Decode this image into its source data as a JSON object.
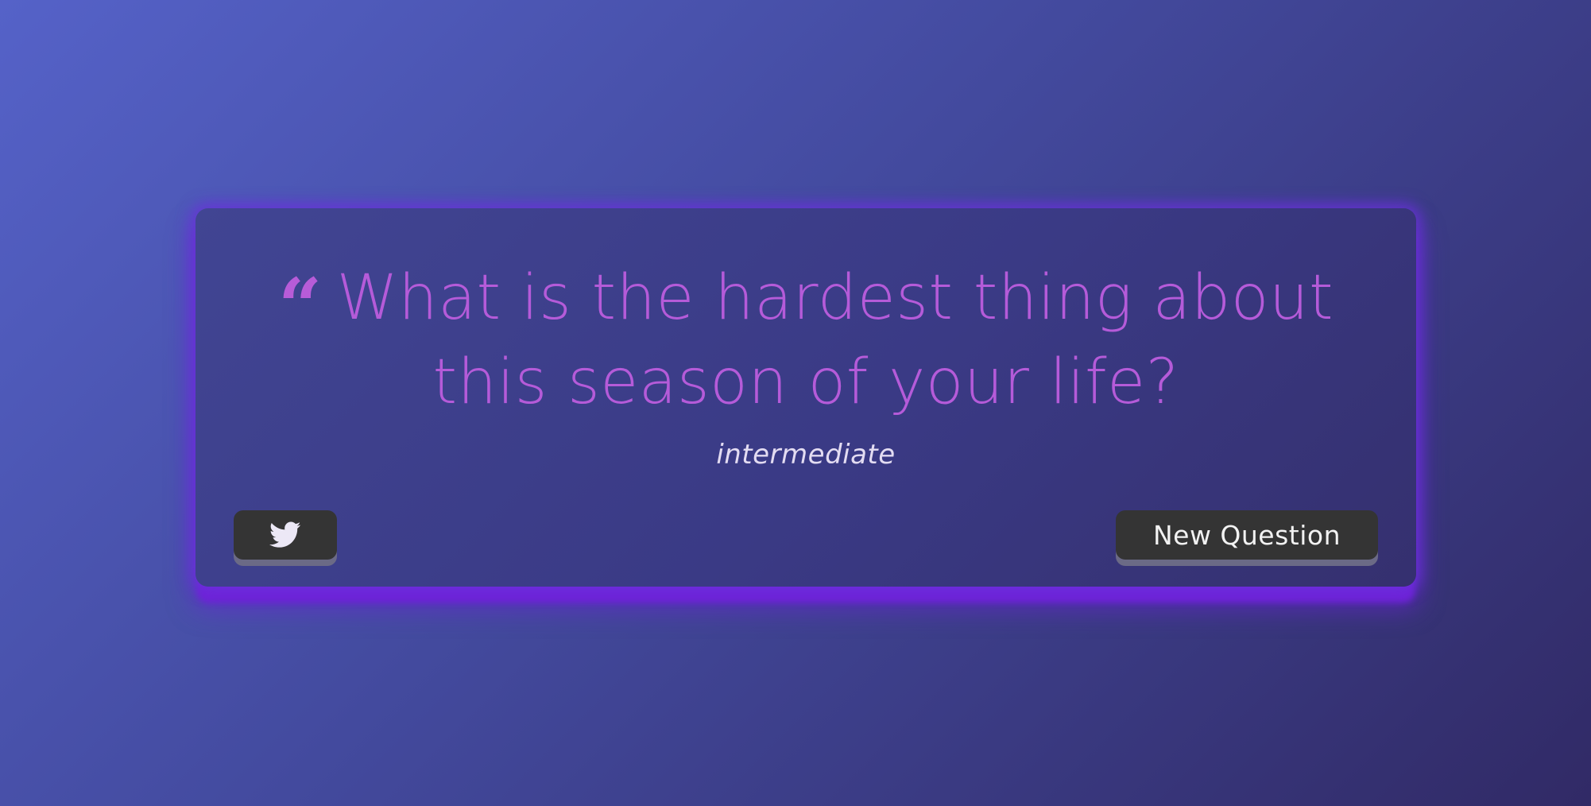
{
  "quote": {
    "mark_icon": "quote-left-icon",
    "text": "What is the hardest thing about this season of your life?",
    "color": "#b55bd9"
  },
  "category": {
    "label": "intermediate"
  },
  "buttons": {
    "twitter_icon": "twitter-icon",
    "new_question_label": "New Question"
  },
  "colors": {
    "card_glow": "#6f22d8",
    "button_bg": "#343434",
    "button_shadow": "#6b6a86"
  }
}
